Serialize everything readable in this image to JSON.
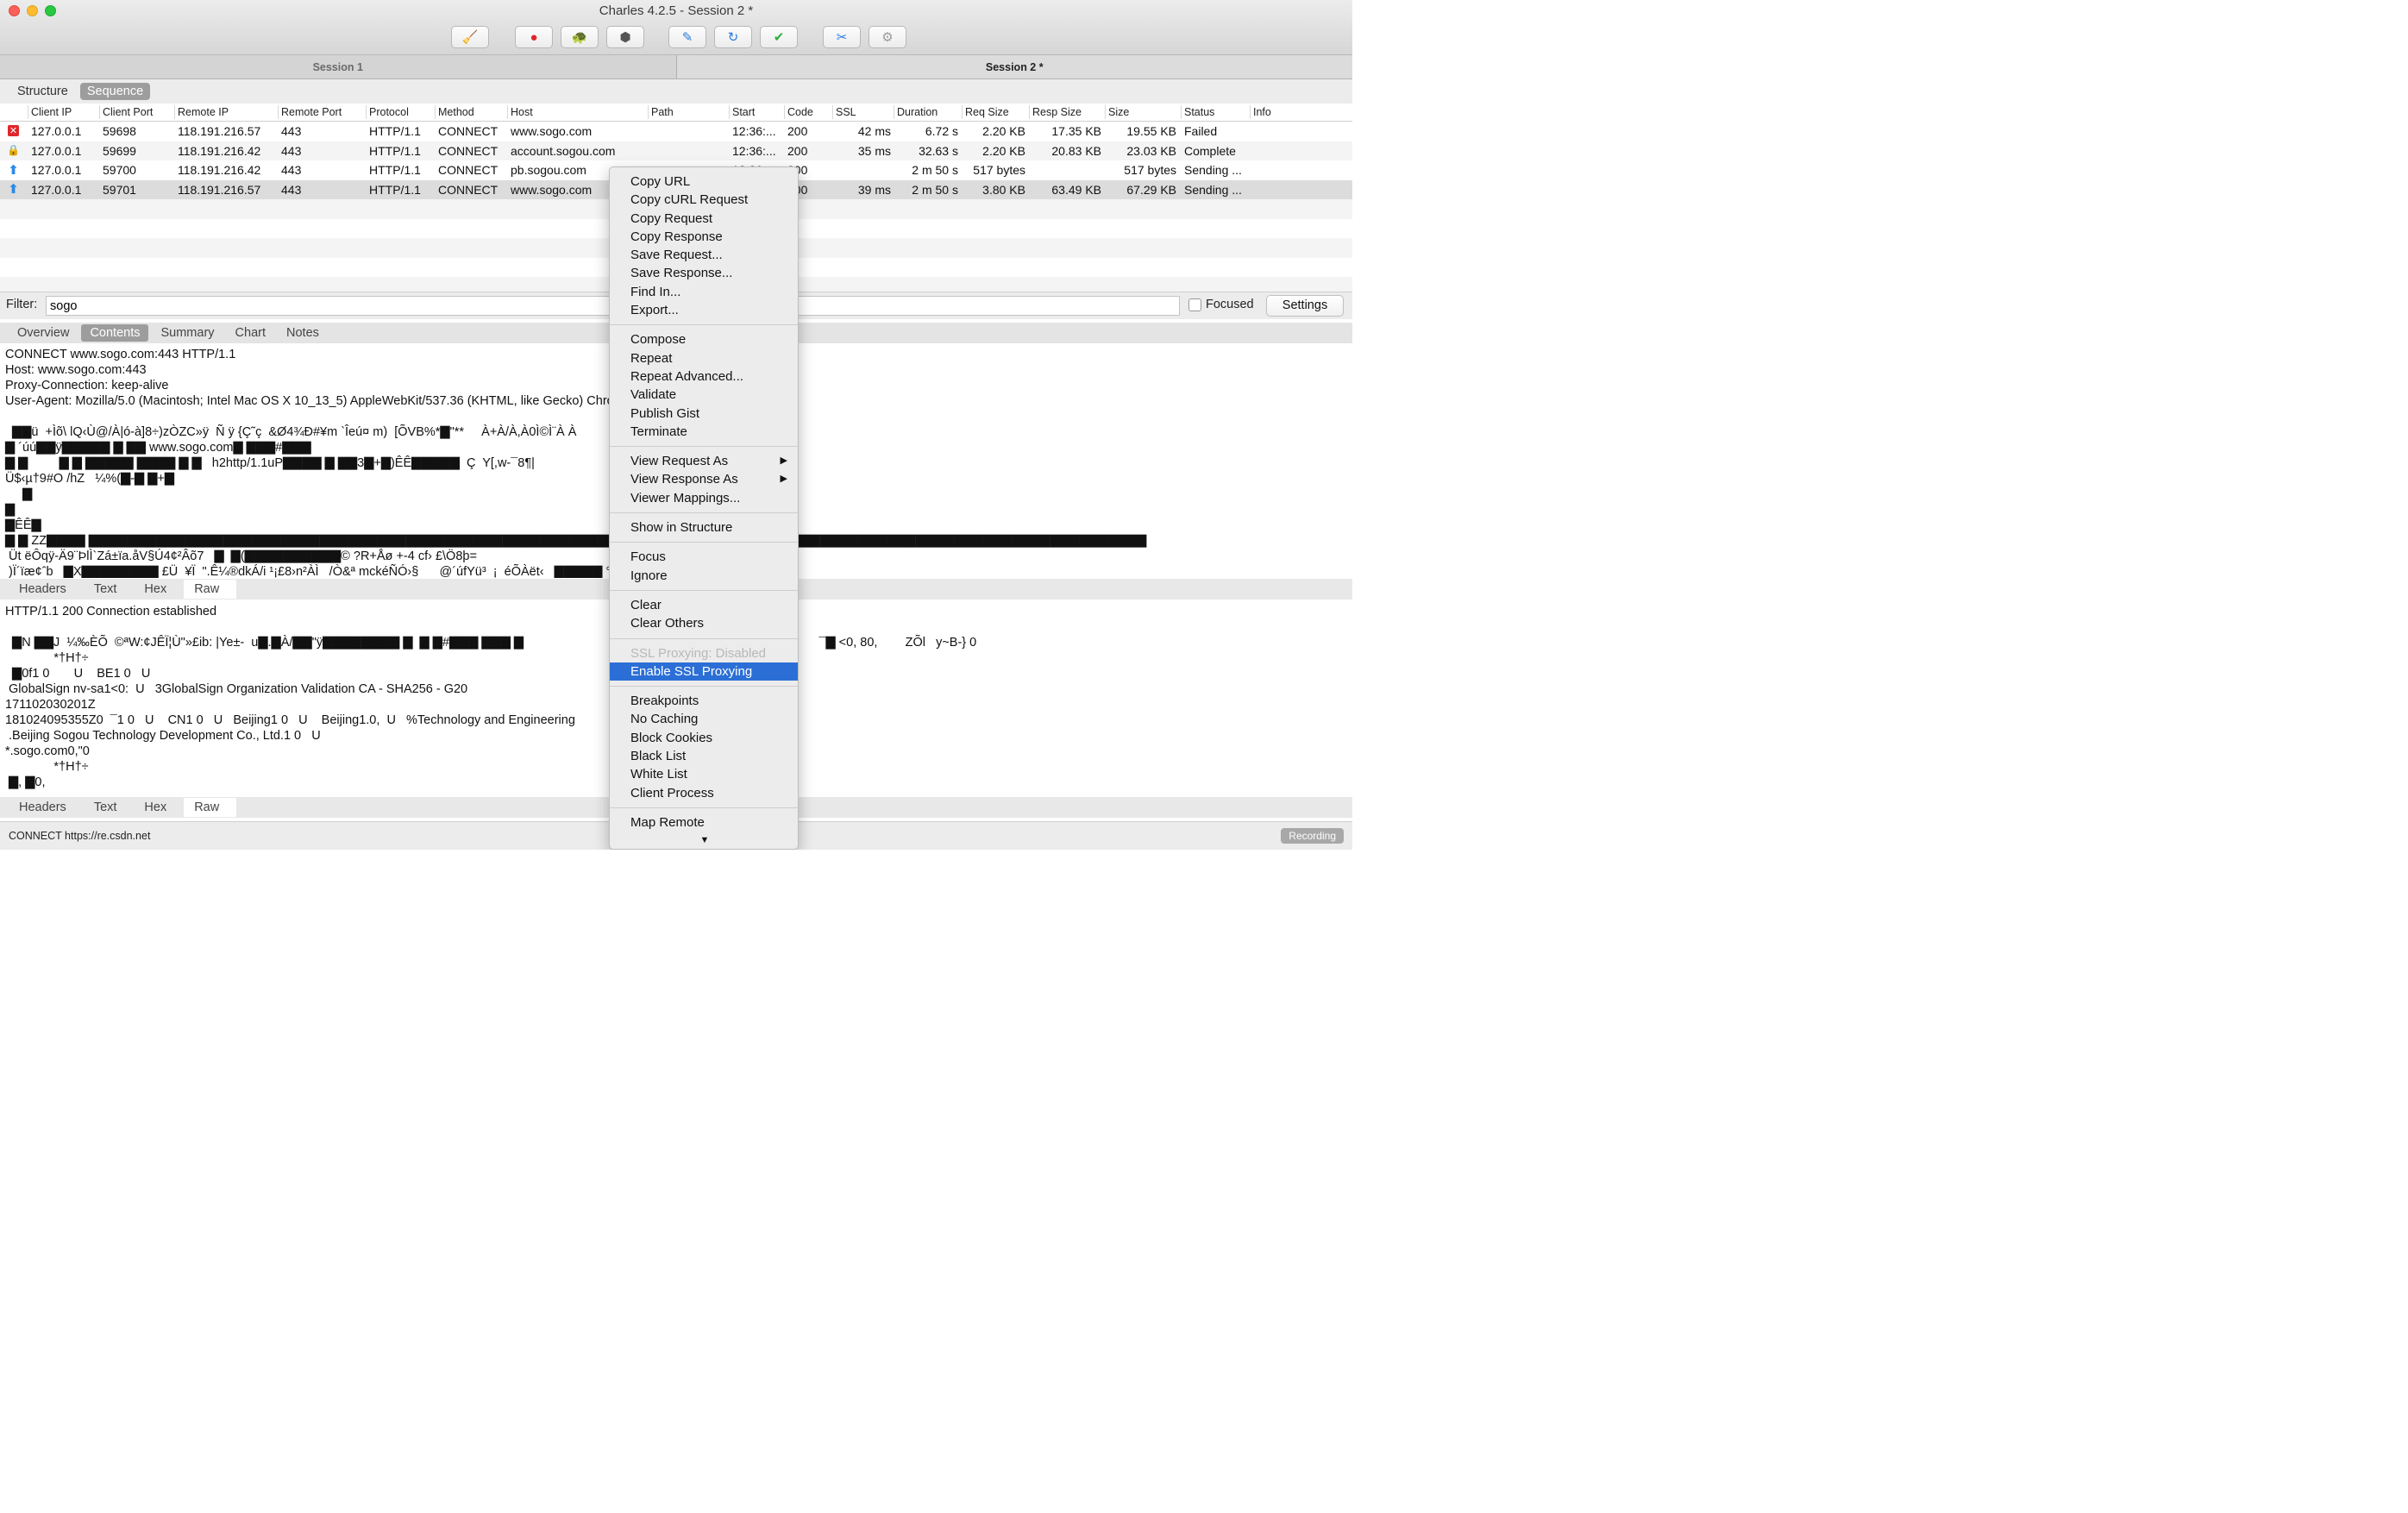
{
  "window": {
    "title": "Charles 4.2.5 - Session 2 *"
  },
  "toolbar": {
    "buttons": [
      {
        "name": "broom-icon",
        "glyph": "🧹",
        "color": "#e8a400"
      },
      {
        "name": "record-icon",
        "glyph": "●",
        "color": "#e0262c"
      },
      {
        "name": "throttle-turtle-icon",
        "glyph": "🐢",
        "color": "#555555"
      },
      {
        "name": "breakpoint-hexagon-icon",
        "glyph": "⬢",
        "color": "#555555"
      },
      {
        "name": "compose-pen-icon",
        "glyph": "✎",
        "color": "#2a7be0"
      },
      {
        "name": "repeat-icon",
        "glyph": "↻",
        "color": "#2a7be0"
      },
      {
        "name": "validate-check-icon",
        "glyph": "✔",
        "color": "#2fae3b"
      },
      {
        "name": "tools-icon",
        "glyph": "✂",
        "color": "#2a7be0"
      },
      {
        "name": "settings-gear-icon",
        "glyph": "⚙",
        "color": "#9a9a9a"
      }
    ]
  },
  "sessions": [
    "Session 1",
    "Session 2 *"
  ],
  "view_tabs": [
    "Structure",
    "Sequence"
  ],
  "table": {
    "columns": [
      "Client IP",
      "Client Port",
      "Remote IP",
      "Remote Port",
      "Protocol",
      "Method",
      "Host",
      "Path",
      "Start",
      "Code",
      "SSL",
      "Duration",
      "Req Size",
      "Resp Size",
      "Size",
      "Status",
      "Info"
    ],
    "rows": [
      {
        "icon": "fail",
        "client_ip": "127.0.0.1",
        "client_port": "59698",
        "remote_ip": "118.191.216.57",
        "remote_port": "443",
        "protocol": "HTTP/1.1",
        "method": "CONNECT",
        "host": "www.sogo.com",
        "path": "",
        "start": "12:36:...",
        "code": "200",
        "ssl": "42 ms",
        "duration": "6.72 s",
        "req_size": "2.20 KB",
        "resp_size": "17.35 KB",
        "size": "19.55 KB",
        "status": "Failed"
      },
      {
        "icon": "lock",
        "client_ip": "127.0.0.1",
        "client_port": "59699",
        "remote_ip": "118.191.216.42",
        "remote_port": "443",
        "protocol": "HTTP/1.1",
        "method": "CONNECT",
        "host": "account.sogou.com",
        "path": "",
        "start": "12:36:...",
        "code": "200",
        "ssl": "35 ms",
        "duration": "32.63 s",
        "req_size": "2.20 KB",
        "resp_size": "20.83 KB",
        "size": "23.03 KB",
        "status": "Complete"
      },
      {
        "icon": "up",
        "client_ip": "127.0.0.1",
        "client_port": "59700",
        "remote_ip": "118.191.216.42",
        "remote_port": "443",
        "protocol": "HTTP/1.1",
        "method": "CONNECT",
        "host": "pb.sogou.com",
        "path": "",
        "start": "12:36:...",
        "code": "200",
        "ssl": "",
        "duration": "2 m 50 s",
        "req_size": "517 bytes",
        "resp_size": "",
        "size": "517 bytes",
        "status": "Sending ..."
      },
      {
        "icon": "up",
        "client_ip": "127.0.0.1",
        "client_port": "59701",
        "remote_ip": "118.191.216.57",
        "remote_port": "443",
        "protocol": "HTTP/1.1",
        "method": "CONNECT",
        "host": "www.sogo.com",
        "path": "",
        "start": "12:36:...",
        "code": "200",
        "ssl": "39 ms",
        "duration": "2 m 50 s",
        "req_size": "3.80 KB",
        "resp_size": "63.49 KB",
        "size": "67.29 KB",
        "status": "Sending ..."
      }
    ]
  },
  "filter": {
    "label": "Filter:",
    "value": "sogo",
    "focused_label": "Focused",
    "settings_label": "Settings"
  },
  "detail_tabs": [
    "Overview",
    "Contents",
    "Summary",
    "Chart",
    "Notes"
  ],
  "request_text": "CONNECT www.sogo.com:443 HTTP/1.1\nHost: www.sogo.com:443\nProxy-Connection: keep-alive\nUser-Agent: Mozilla/5.0 (Macintosh; Intel Mac OS X 10_13_5) AppleWebKit/537.36 (KHTML, like Gecko) Chrome/67.0.3396.99 Safari/537.36\n\n  ▇▇ü  +Ìõ\\ lQ‹Ù@/À|ó-à]8÷)zÒZC»ÿ  Ñ ÿ {Ç˜ç  &Ø4¾Ð#¥m `Îeú¤ m)  [ÕVB%*▇\"**     À+À/À,À0Ì©Ì¨À À   \n▇ ´úú▇▇ÿ▇▇▇▇▇ ▇ ▇▇ www.sogo.com▇ ▇▇▇#▇▇▇\n▇ ▇         ▇ ▇ ▇▇▇▇▇ ▇▇▇▇ ▇ ▇   h2http/1.1uP▇▇▇▇ ▇ ▇▇3▇+▇)ÊÊ▇▇▇▇▇  Ç  Y[,w-¯8¶|\nÜ$‹µ†9#O /hZ   ¼%(▇-▇ ▇+▇\n     ▇\n▇\n▇ÊÊ▇\n▇ ▇ ZZ▇▇▇▇ ▇▇▇▇▇▇▇▇▇▇▇▇▇▇▇▇▇▇▇▇▇▇▇▇▇▇▇▇▇▇▇▇▇▇▇▇▇▇▇▇▇▇▇▇▇▇▇▇▇▇▇▇▇▇▇▇▇▇▇▇▇▇▇▇▇▇▇▇▇▇▇▇▇▇▇▇▇▇▇▇▇▇▇▇▇▇▇▇▇▇▇▇▇▇▇▇▇▇▇▇▇▇▇▇▇▇▇▇▇▇\n Üt ëÔqÿ-Ä9¨ÞlÌ`Zá±ïa.åV§Ú4¢²Âõ7   ▇  ▇(▇▇▇▇▇▇▇▇▇▇© ?R+Åø +-4 cf› £\\Ö8þ=\n )Ï´ïæ¢ˆb   ▇X▇▇▇▇▇▇▇▇ £Ü  ¥Ï  \".Ê¼®dkÁ/i ¹¡£8›n²ÀÌ   /Ò&ª mckéÑÓ›§      @´úfYü³  ¡  éÕÀët‹   ▇▇▇▇▇ °.† £›u§uö47+˜  :'*ÊY-)&9   ß-Ù",
  "request_subtabs": [
    "Headers",
    "Text",
    "Hex",
    "Raw"
  ],
  "response_text": "HTTP/1.1 200 Connection established\n\n  ▇N ▇▇J  ¼‰ÈÕ  ©ªW:¢JÊÏ¦Ù\"»£ib: |Ye±-  u▇.▇À/▇▇\"ÿ▇▇▇▇▇▇▇▇ ▇  ▇ ▇#▇▇▇ ▇▇▇ ▇                                                                                     ¯▇ <0, 80,        ZÕl   y~B-} 0\n              *†H†÷\n  ▇0f1 0       U    BE1 0   U\n GlobalSign nv-sa1<0:  U   3GlobalSign Organization Validation CA - SHA256 - G20\n171102030201Z\n181024095355Z0  ¯1 0   U    CN1 0   U   Beijing1 0   U    Beijing1.0,  U   %Technology and Engineering\n .Beijing Sogou Technology Development Co., Ltd.1 0   U\n*.sogo.com0,\"0\n              *†H†÷\n ▇, ▇0,",
  "response_subtabs": [
    "Headers",
    "Text",
    "Hex",
    "Raw"
  ],
  "status_bar": {
    "text": "CONNECT https://re.csdn.net",
    "recording": "Recording"
  },
  "context_menu": {
    "groups": [
      [
        "Copy URL",
        "Copy cURL Request",
        "Copy Request",
        "Copy Response",
        "Save Request...",
        "Save Response...",
        "Find In...",
        "Export..."
      ],
      [
        "Compose",
        "Repeat",
        "Repeat Advanced...",
        "Validate",
        "Publish Gist",
        "Terminate"
      ],
      [
        "View Request As",
        "View Response As",
        "Viewer Mappings..."
      ],
      [
        "Show in Structure"
      ],
      [
        "Focus",
        "Ignore"
      ],
      [
        "Clear",
        "Clear Others"
      ],
      [
        "SSL Proxying: Disabled",
        "Enable SSL Proxying"
      ],
      [
        "Breakpoints",
        "No Caching",
        "Block Cookies",
        "Black List",
        "White List",
        "Client Process"
      ],
      [
        "Map Remote"
      ]
    ],
    "submenu_items": [
      "View Request As",
      "View Response As"
    ],
    "disabled_items": [
      "SSL Proxying: Disabled"
    ],
    "highlighted_item": "Enable SSL Proxying",
    "more_indicator": "▼"
  }
}
